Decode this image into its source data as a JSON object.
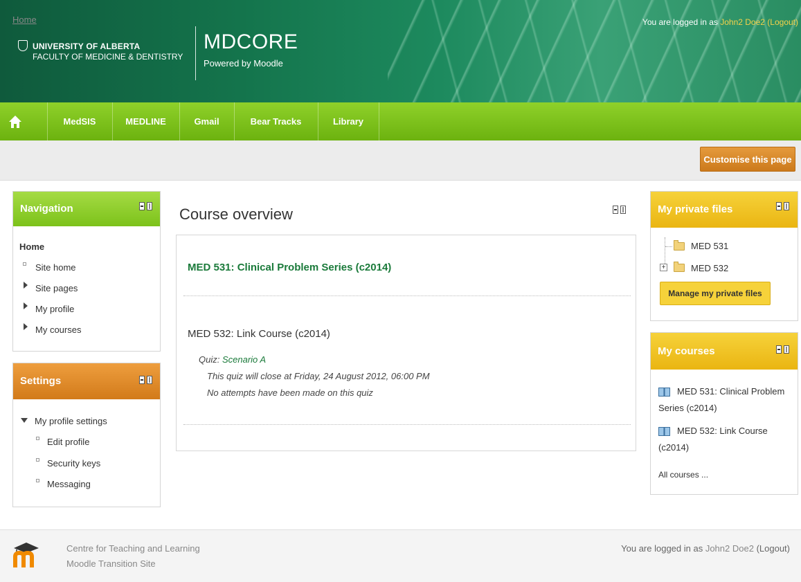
{
  "header": {
    "university_line1": "UNIVERSITY OF ALBERTA",
    "university_line2": "FACULTY OF MEDICINE & DENTISTRY",
    "site_title": "MDCORE",
    "site_subtitle": "Powered by Moodle",
    "login_prefix": "You are logged in as ",
    "user_name": "John2 Doe2",
    "logout_label": "(Logout)"
  },
  "navbar": {
    "items": [
      {
        "label": "MedSIS"
      },
      {
        "label": "MEDLINE"
      },
      {
        "label": "Gmail"
      },
      {
        "label": "Bear Tracks"
      },
      {
        "label": "Library"
      }
    ]
  },
  "breadcrumb": {
    "home": "Home"
  },
  "customise_button": "Customise this page",
  "navigation_block": {
    "title": "Navigation",
    "home": "Home",
    "items": [
      "Site home",
      "Site pages",
      "My profile",
      "My courses"
    ]
  },
  "settings_block": {
    "title": "Settings",
    "section": "My profile settings",
    "items": [
      "Edit profile",
      "Security keys",
      "Messaging"
    ]
  },
  "main": {
    "title": "Course overview",
    "course1": "MED 531: Clinical Problem Series (c2014)",
    "course2": "MED 532: Link Course (c2014)",
    "quiz_label": "Quiz: ",
    "quiz_name": "Scenario A",
    "quiz_close": "This quiz will close at Friday, 24 August 2012, 06:00 PM",
    "quiz_attempts": "No attempts have been made on this quiz"
  },
  "private_files_block": {
    "title": "My private files",
    "folders": [
      "MED 531",
      "MED 532"
    ],
    "manage_button": "Manage my private files"
  },
  "my_courses_block": {
    "title": "My courses",
    "course1_line1": "MED 531: Clinical Problem",
    "course1_line2": "Series (c2014)",
    "course2_line1": "MED 532: Link Course",
    "course2_line2": "(c2014)",
    "all_courses": "All courses ..."
  },
  "footer": {
    "line1": "Centre for Teaching and Learning",
    "line2": "Moodle Transition Site",
    "login_prefix": "You are logged in as ",
    "user_name": "John2 Doe2",
    "logout_label": "(Logout)"
  },
  "colors": {
    "header_green": "#14744c",
    "navbar_green": "#7cc21a",
    "navigation_head": "#8ccf2e",
    "settings_head": "#de8a26",
    "yellow_head": "#f0c21a",
    "link_green": "#1a7a3a"
  }
}
